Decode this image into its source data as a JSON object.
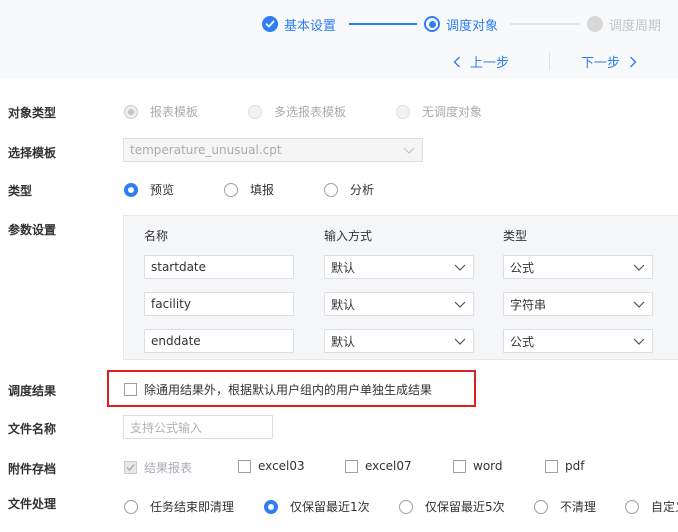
{
  "steps": [
    {
      "label": "基本设置",
      "state": "done"
    },
    {
      "label": "调度对象",
      "state": "active"
    },
    {
      "label": "调度周期",
      "state": "pending"
    }
  ],
  "nav": {
    "prev": "上一步",
    "next": "下一步"
  },
  "object_type": {
    "label": "对象类型",
    "options": [
      "报表模板",
      "多选报表模板",
      "无调度对象"
    ],
    "selected": "报表模板"
  },
  "template": {
    "label": "选择模板",
    "value": "temperature_unusual.cpt"
  },
  "type": {
    "label": "类型",
    "options": [
      "预览",
      "填报",
      "分析"
    ],
    "selected": "预览"
  },
  "params": {
    "label": "参数设置",
    "headers": [
      "名称",
      "输入方式",
      "类型"
    ],
    "rows": [
      {
        "name": "startdate",
        "input_method": "默认",
        "type": "公式"
      },
      {
        "name": "facility",
        "input_method": "默认",
        "type": "字符串"
      },
      {
        "name": "enddate",
        "input_method": "默认",
        "type": "公式"
      }
    ]
  },
  "schedule_result": {
    "label": "调度结果",
    "checkbox_text": "除通用结果外，根据默认用户组内的用户单独生成结果",
    "checked": false
  },
  "file_name": {
    "label": "文件名称",
    "placeholder": "支持公式输入",
    "value": ""
  },
  "attachment": {
    "label": "附件存档",
    "options": [
      {
        "label": "结果报表",
        "checked": true,
        "disabled": true
      },
      {
        "label": "excel03",
        "checked": false
      },
      {
        "label": "excel07",
        "checked": false
      },
      {
        "label": "word",
        "checked": false
      },
      {
        "label": "pdf",
        "checked": false
      }
    ]
  },
  "file_handling": {
    "label": "文件处理",
    "options": [
      "任务结束即清理",
      "仅保留最近1次",
      "仅保留最近5次",
      "不清理",
      "自定义"
    ],
    "selected": "仅保留最近1次"
  },
  "colors": {
    "accent": "#2d7df6",
    "highlight": "#e02020"
  }
}
